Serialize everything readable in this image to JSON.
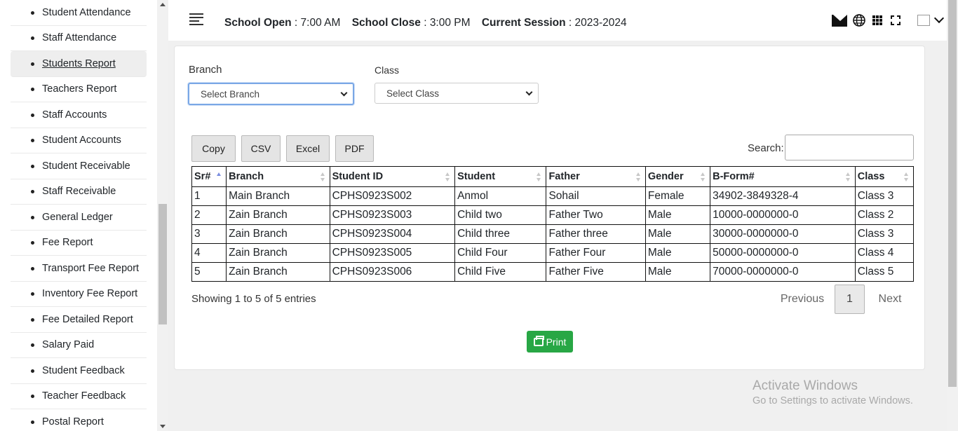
{
  "sidebar": {
    "items": [
      {
        "label": "Student Attendance"
      },
      {
        "label": "Staff Attendance"
      },
      {
        "label": "Students Report"
      },
      {
        "label": "Teachers Report"
      },
      {
        "label": "Staff Accounts"
      },
      {
        "label": "Student Accounts"
      },
      {
        "label": "Student Receivable"
      },
      {
        "label": "Staff Receivable"
      },
      {
        "label": "General Ledger"
      },
      {
        "label": "Fee Report"
      },
      {
        "label": "Transport Fee Report"
      },
      {
        "label": "Inventory Fee Report"
      },
      {
        "label": "Fee Detailed Report"
      },
      {
        "label": "Salary Paid"
      },
      {
        "label": "Student Feedback"
      },
      {
        "label": "Teacher Feedback"
      },
      {
        "label": "Postal Report"
      }
    ],
    "active": "Students Report"
  },
  "header": {
    "open_label": "School Open",
    "open_value": "7:00 AM",
    "close_label": "School Close",
    "close_value": "3:00 PM",
    "session_label": "Current Session",
    "session_value": "2023-2024",
    "icons": [
      "menu-icon",
      "mail-icon",
      "globe-icon",
      "grid-icon",
      "fullscreen-icon",
      "avatar",
      "chevron-down-icon"
    ]
  },
  "filters": {
    "branch_label": "Branch",
    "branch_value": "Select Branch",
    "class_label": "Class",
    "class_value": "Select Class"
  },
  "toolbar": {
    "copy": "Copy",
    "csv": "CSV",
    "excel": "Excel",
    "pdf": "PDF",
    "search_label": "Search:",
    "search_value": ""
  },
  "table": {
    "headers": [
      "Sr#",
      "Branch",
      "Student ID",
      "Student",
      "Father",
      "Gender",
      "B-Form#",
      "Class"
    ],
    "rows": [
      [
        "1",
        "Main Branch",
        "CPHS0923S002",
        "Anmol",
        "Sohail",
        "Female",
        "34902-3849328-4",
        "Class 3"
      ],
      [
        "2",
        "Zain Branch",
        "CPHS0923S003",
        "Child two",
        "Father Two",
        "Male",
        "10000-0000000-0",
        "Class 2"
      ],
      [
        "3",
        "Zain Branch",
        "CPHS0923S004",
        "Child three",
        "Father three",
        "Male",
        "30000-0000000-0",
        "Class 3"
      ],
      [
        "4",
        "Zain Branch",
        "CPHS0923S005",
        "Child Four",
        "Father Four",
        "Male",
        "50000-0000000-0",
        "Class 4"
      ],
      [
        "5",
        "Zain Branch",
        "CPHS0923S006",
        "Child Five",
        "Father Five",
        "Male",
        "70000-0000000-0",
        "Class 5"
      ]
    ]
  },
  "footer": {
    "showing": "Showing 1 to 5 of 5 entries",
    "previous": "Previous",
    "page": "1",
    "next": "Next",
    "print": "Print"
  },
  "watermark": {
    "line1": "Activate Windows",
    "line2": "Go to Settings to activate Windows."
  },
  "colors": {
    "print_button": "#28a745",
    "sort_active": "#7b8ee0",
    "select_focus": "#7aa7e6"
  }
}
